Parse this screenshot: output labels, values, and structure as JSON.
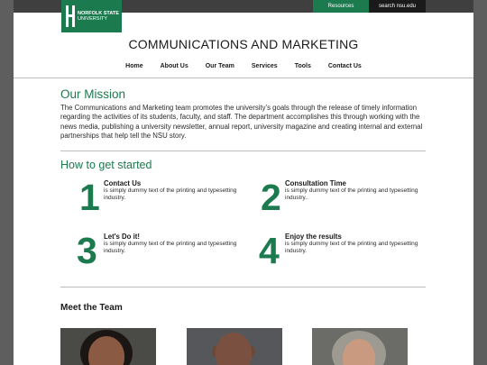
{
  "header": {
    "logo_line1": "NORFOLK STATE",
    "logo_line2": "UNIVERSITY",
    "resources_link": "Resources",
    "search_link": "search nsu.edu",
    "site_title": "COMMUNICATIONS AND MARKETING"
  },
  "nav": {
    "items": [
      "Home",
      "About Us",
      "Our Team",
      "Services",
      "Tools",
      "Contact Us"
    ]
  },
  "mission": {
    "heading": "Our Mission",
    "text": "The Communications and Marketing team promotes the university’s goals through the release of timely information regarding the activities of its students, faculty, and staff. The department accomplishes this through working with the news media, publishing a university newsletter, annual report, university magazine and creating internal and external partnerships that help tell the NSU story."
  },
  "get_started": {
    "heading": "How to get started",
    "steps": [
      {
        "number": "1",
        "title": "Contact Us",
        "desc": "is simply dummy text of the printing and typesetting industry."
      },
      {
        "number": "2",
        "title": "Consultation Time",
        "desc": "is simply dummy text of the printing and typesetting industry.."
      },
      {
        "number": "3",
        "title": "Let's Do it!",
        "desc": "is simply dummy text of the printing and typesetting industry."
      },
      {
        "number": "4",
        "title": "Enjoy the results",
        "desc": "is simply dummy text of the printing and typesetting industry."
      }
    ]
  },
  "team": {
    "heading": "Meet the Team"
  },
  "colors": {
    "brand_green": "#1c7a4f",
    "top_bar": "#3f3f3f",
    "backdrop": "#5e5e5e"
  }
}
